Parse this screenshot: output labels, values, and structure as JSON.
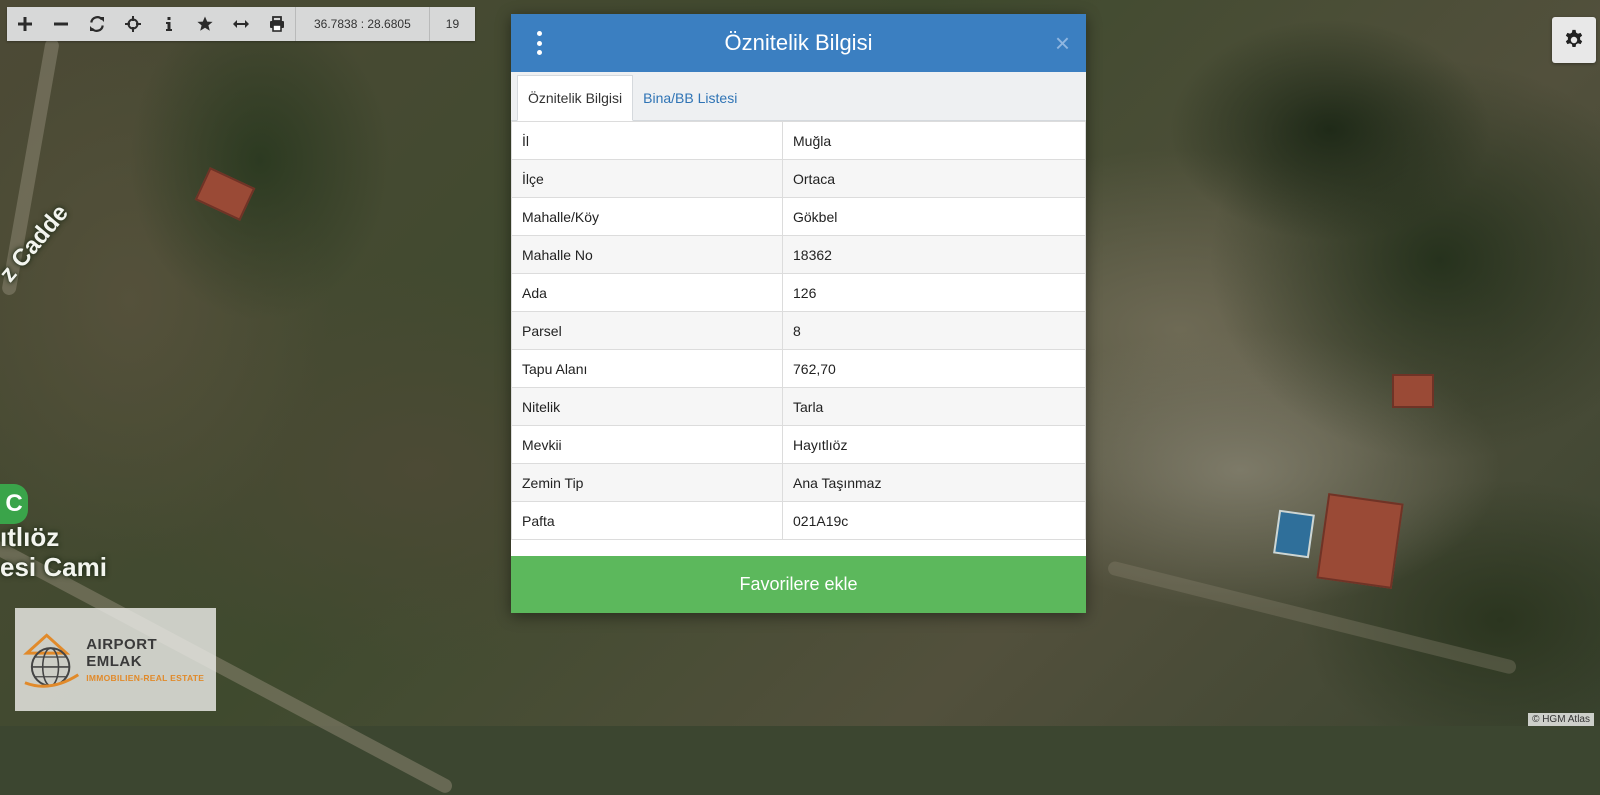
{
  "toolbar": {
    "coordinates": "36.7838 : 28.6805",
    "zoom": "19",
    "icons": [
      "plus-icon",
      "minus-icon",
      "refresh-icon",
      "crosshair-icon",
      "info-icon",
      "star-icon",
      "measure-icon",
      "print-icon"
    ]
  },
  "map": {
    "labels": [
      "z Cadde",
      "ıtlıöz",
      "esi Cami"
    ],
    "poi_marker": "C",
    "attribution": "© HGM Atlas"
  },
  "dialog": {
    "title": "Öznitelik Bilgisi",
    "close_label": "×",
    "tabs": [
      {
        "label": "Öznitelik Bilgisi",
        "active": true
      },
      {
        "label": "Bina/BB Listesi",
        "active": false
      }
    ],
    "rows": [
      {
        "key": "İl",
        "value": "Muğla"
      },
      {
        "key": "İlçe",
        "value": "Ortaca"
      },
      {
        "key": "Mahalle/Köy",
        "value": "Gökbel"
      },
      {
        "key": "Mahalle No",
        "value": "18362"
      },
      {
        "key": "Ada",
        "value": "126"
      },
      {
        "key": "Parsel",
        "value": "8"
      },
      {
        "key": "Tapu Alanı",
        "value": "762,70"
      },
      {
        "key": "Nitelik",
        "value": "Tarla"
      },
      {
        "key": "Mevkii",
        "value": "Hayıtlıöz"
      },
      {
        "key": "Zemin Tip",
        "value": "Ana Taşınmaz"
      },
      {
        "key": "Pafta",
        "value": "021A19c"
      }
    ],
    "favorite_button": "Favorilere ekle"
  },
  "logo": {
    "name": "AIRPORT EMLAK",
    "subtitle": "IMMOBILIEN-REAL ESTATE"
  },
  "colors": {
    "header": "#3b7fc1",
    "favorite": "#5cb85c",
    "tab_link": "#2f74b5"
  }
}
